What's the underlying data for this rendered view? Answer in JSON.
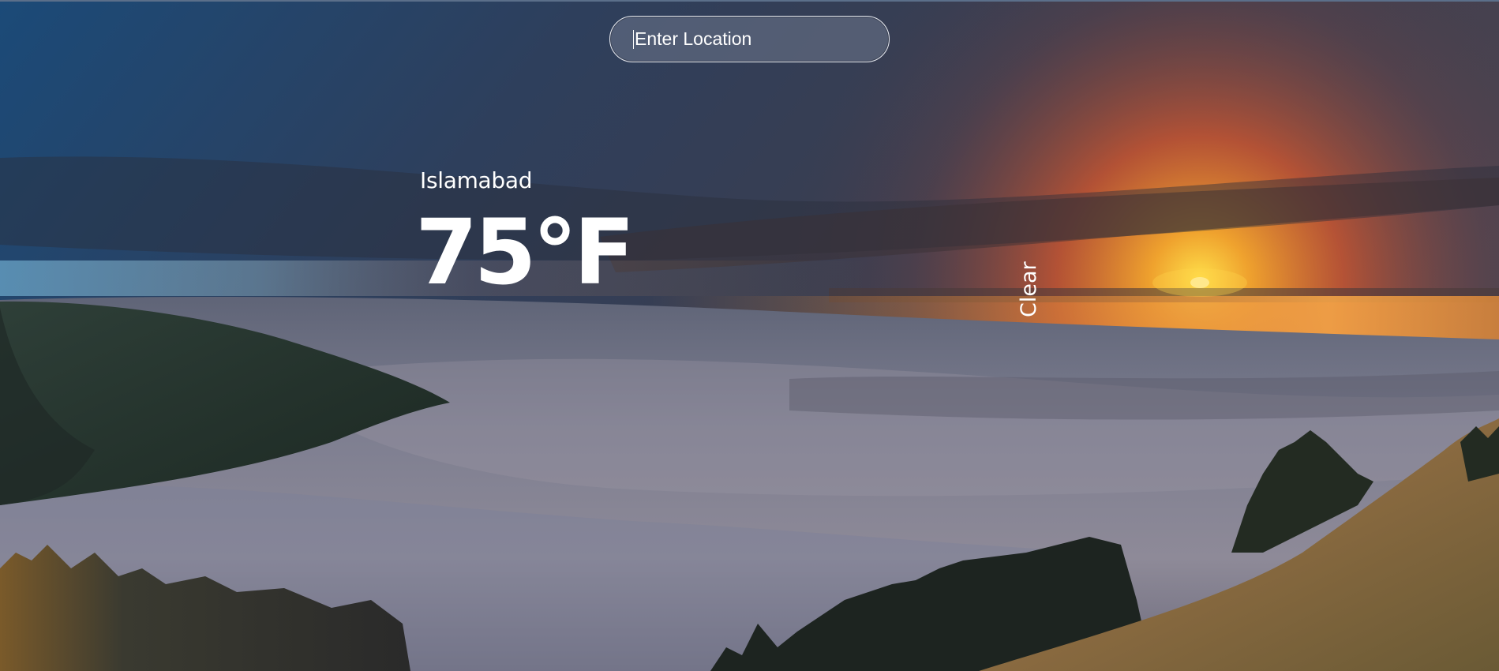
{
  "search": {
    "placeholder": "Enter Location",
    "value": ""
  },
  "weather": {
    "city": "Islamabad",
    "temperature": "75°F",
    "condition": "Clear"
  },
  "colors": {
    "text": "#ffffff",
    "sky_top": "#1f3f66",
    "sunset_orange": "#f08a2a",
    "fog": "#7c7f8f"
  },
  "background": {
    "icon": "sunset-over-fog-landscape"
  }
}
